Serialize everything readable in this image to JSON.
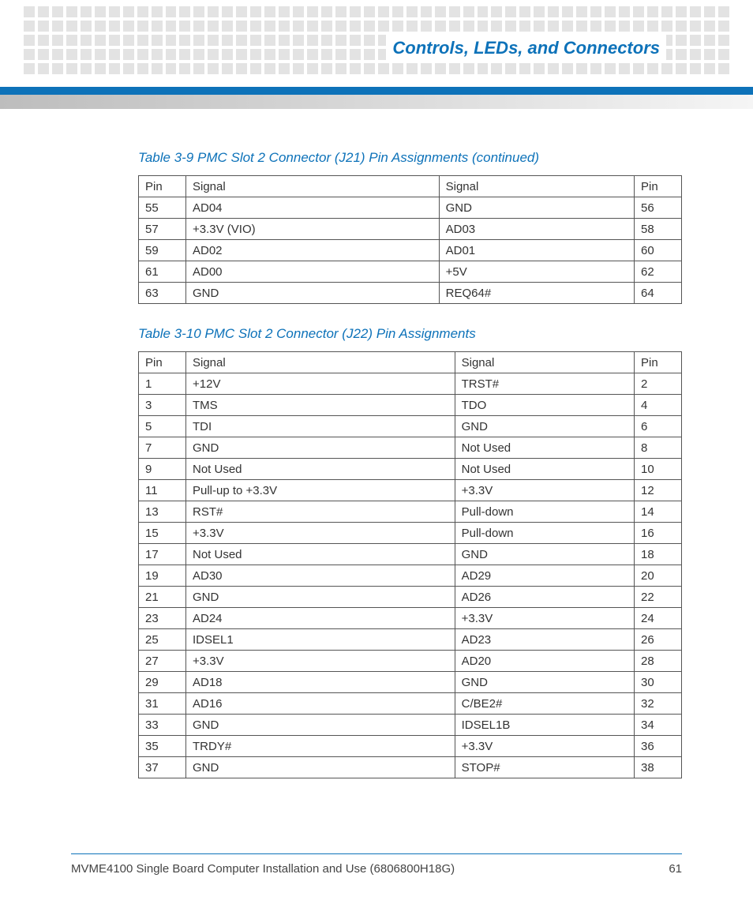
{
  "header": {
    "title": "Controls, LEDs, and Connectors"
  },
  "table1": {
    "caption": "Table 3-9 PMC Slot 2 Connector (J21) Pin Assignments (continued)",
    "headers": [
      "Pin",
      "Signal",
      "Signal",
      "Pin"
    ],
    "rows": [
      [
        "55",
        "AD04",
        "GND",
        "56"
      ],
      [
        "57",
        "+3.3V (VIO)",
        "AD03",
        "58"
      ],
      [
        "59",
        "AD02",
        "AD01",
        "60"
      ],
      [
        "61",
        "AD00",
        "+5V",
        "62"
      ],
      [
        "63",
        "GND",
        "REQ64#",
        "64"
      ]
    ]
  },
  "table2": {
    "caption": "Table 3-10 PMC Slot 2 Connector (J22) Pin Assignments",
    "headers": [
      "Pin",
      "Signal",
      "Signal",
      "Pin"
    ],
    "rows": [
      [
        "1",
        "+12V",
        "TRST#",
        "2"
      ],
      [
        "3",
        "TMS",
        "TDO",
        "4"
      ],
      [
        "5",
        "TDI",
        "GND",
        "6"
      ],
      [
        "7",
        "GND",
        "Not Used",
        "8"
      ],
      [
        "9",
        "Not Used",
        "Not Used",
        "10"
      ],
      [
        "11",
        "Pull-up to +3.3V",
        "+3.3V",
        "12"
      ],
      [
        "13",
        "RST#",
        "Pull-down",
        "14"
      ],
      [
        "15",
        "+3.3V",
        "Pull-down",
        "16"
      ],
      [
        "17",
        "Not Used",
        "GND",
        "18"
      ],
      [
        "19",
        "AD30",
        "AD29",
        "20"
      ],
      [
        "21",
        "GND",
        "AD26",
        "22"
      ],
      [
        "23",
        "AD24",
        "+3.3V",
        "24"
      ],
      [
        "25",
        "IDSEL1",
        "AD23",
        "26"
      ],
      [
        "27",
        "+3.3V",
        "AD20",
        "28"
      ],
      [
        "29",
        "AD18",
        "GND",
        "30"
      ],
      [
        "31",
        "AD16",
        "C/BE2#",
        "32"
      ],
      [
        "33",
        "GND",
        "IDSEL1B",
        "34"
      ],
      [
        "35",
        "TRDY#",
        "+3.3V",
        "36"
      ],
      [
        "37",
        "GND",
        "STOP#",
        "38"
      ]
    ]
  },
  "footer": {
    "doc": "MVME4100 Single Board Computer Installation and Use (6806800H18G)",
    "page": "61"
  }
}
